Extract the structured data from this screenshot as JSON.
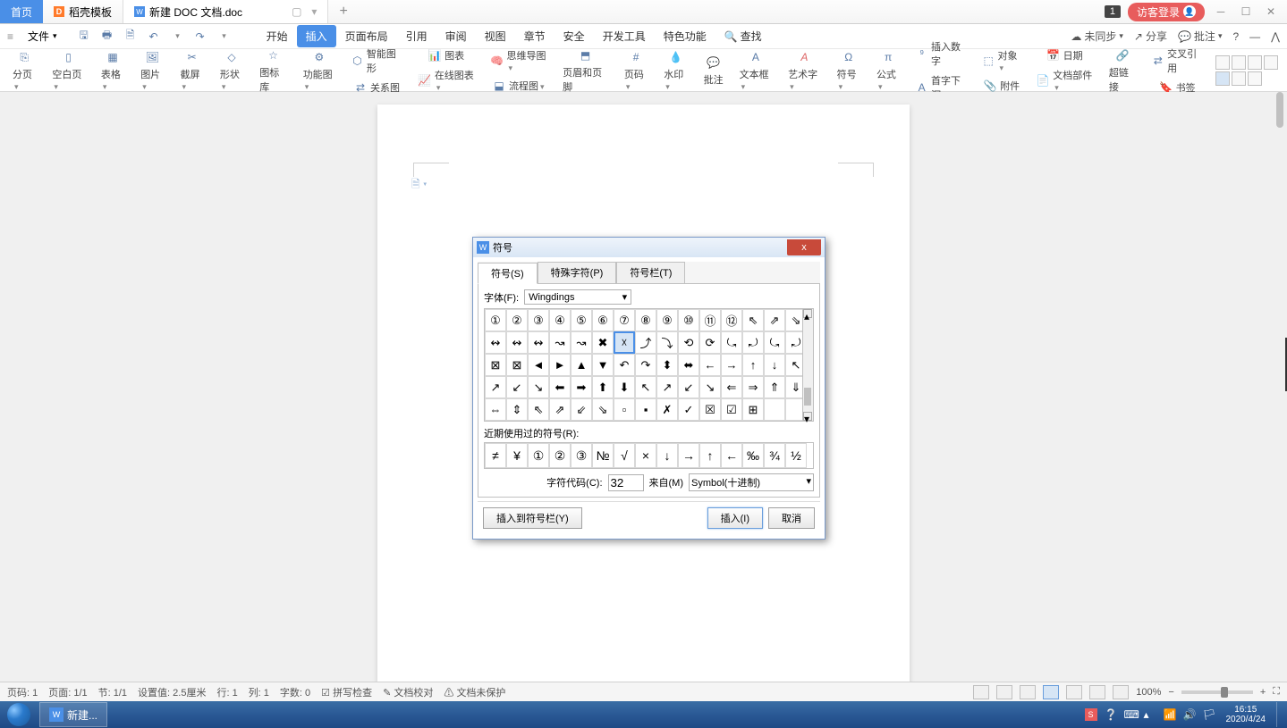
{
  "tabs": {
    "home": "首页",
    "template_icon": "D",
    "template": "稻壳模板",
    "doc": "新建 DOC 文档.doc"
  },
  "titlebar": {
    "badge": "1",
    "login": "访客登录"
  },
  "file_menu": "文件",
  "menutabs": [
    "开始",
    "插入",
    "页面布局",
    "引用",
    "审阅",
    "视图",
    "章节",
    "安全",
    "开发工具",
    "特色功能"
  ],
  "search": "查找",
  "menuright": {
    "sync": "未同步",
    "share": "分享",
    "comment": "批注"
  },
  "ribbon": {
    "page_break": "分页",
    "blank": "空白页",
    "table": "表格",
    "picture": "图片",
    "screenshot": "截屏",
    "shapes": "形状",
    "icons": "图标库",
    "addin": "功能图",
    "smart_shape": "智能图形",
    "chart": "图表",
    "mindmap": "思维导图",
    "relation": "关系图",
    "online_chart": "在线图表",
    "flowchart": "流程图",
    "header_footer": "页眉和页脚",
    "page_num": "页码",
    "watermark": "水印",
    "comment": "批注",
    "textbox": "文本框",
    "wordart": "艺术字",
    "symbol": "符号",
    "equation": "公式",
    "insert_num": "插入数字",
    "object": "对象",
    "date": "日期",
    "dropcap": "首字下沉",
    "attachment": "附件",
    "hyperlink": "超链接",
    "crossref": "交叉引用",
    "docparts": "文档部件",
    "bookmark": "书签"
  },
  "dialog": {
    "title": "符号",
    "tabs": [
      "符号(S)",
      "特殊字符(P)",
      "符号栏(T)"
    ],
    "font_label": "字体(F):",
    "font_value": "Wingdings",
    "recent_label": "近期使用过的符号(R):",
    "code_label": "字符代码(C):",
    "code_value": "32",
    "from_label": "来自(M)",
    "from_value": "Symbol(十进制)",
    "insert_to_bar": "插入到符号栏(Y)",
    "insert": "插入(I)",
    "cancel": "取消",
    "grid": [
      [
        "①",
        "②",
        "③",
        "④",
        "⑤",
        "⑥",
        "⑦",
        "⑧",
        "⑨",
        "⑩",
        "⑪",
        "⑫",
        "⇖",
        "⇗",
        "⇘"
      ],
      [
        "↭",
        "↭",
        "↭",
        "↝",
        "↝",
        "✖",
        "☓",
        "⤴",
        "⤵",
        "⟲",
        "⟳",
        "⤿",
        "⤾",
        "⤿",
        "⤾"
      ],
      [
        "⊠",
        "⊠",
        "◄",
        "►",
        "▲",
        "▼",
        "↶",
        "↷",
        "⬍",
        "⬌",
        "←",
        "→",
        "↑",
        "↓",
        "↖"
      ],
      [
        "↗",
        "↙",
        "↘",
        "⬅",
        "➡",
        "⬆",
        "⬇",
        "↖",
        "↗",
        "↙",
        "↘",
        "⇐",
        "⇒",
        "⇑",
        "⇓"
      ],
      [
        "⇔",
        "⇕",
        "⇖",
        "⇗",
        "⇙",
        "⇘",
        "▫",
        "▪",
        "✗",
        "✓",
        "☒",
        "☑",
        "⊞",
        "",
        ""
      ]
    ],
    "recent": [
      "≠",
      "¥",
      "①",
      "②",
      "③",
      "№",
      "√",
      "×",
      "↓",
      "→",
      "↑",
      "←",
      "‰",
      "¾",
      "½"
    ]
  },
  "status": {
    "page_num": "页码: 1",
    "page": "页面: 1/1",
    "section": "节: 1/1",
    "pos": "设置值: 2.5厘米",
    "line": "行: 1",
    "col": "列: 1",
    "words": "字数: 0",
    "spell": "拼写检查",
    "proof": "文档校对",
    "protect": "文档未保护",
    "zoom": "100%"
  },
  "taskbar": {
    "app": "新建...",
    "time": "16:15",
    "date": "2020/4/24"
  }
}
